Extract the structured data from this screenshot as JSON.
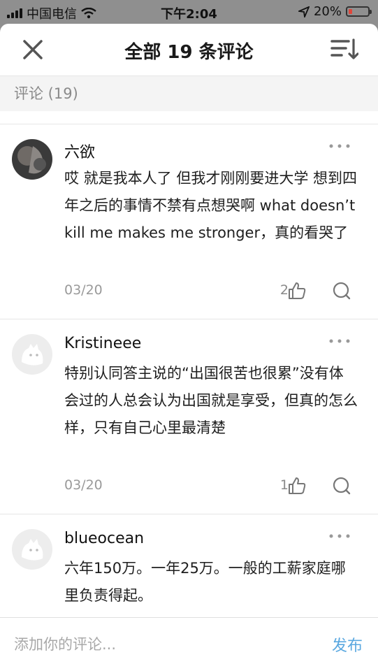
{
  "status_bar": {
    "carrier": "中国电信",
    "time": "下午2:04",
    "battery": "20%",
    "battery_level": 0.2,
    "battery_color": "#e0463a"
  },
  "header": {
    "title": "全部 19 条评论",
    "close_icon": "close-icon",
    "sort_icon": "sort-icon"
  },
  "section": {
    "label": "评论 (19)"
  },
  "comments": [
    {
      "user": "六欲",
      "text": "哎 就是我本人了 但我才刚刚要进大学 想到四年之后的事情不禁有点想哭啊 what doesn’t kill me makes me stronger，真的看哭了",
      "date": "03/20",
      "likes": "2"
    },
    {
      "user": "Kristineee",
      "text": "特别认同答主说的“出国很苦也很累”没有体会过的人总会认为出国就是享受，但真的怎么样，只有自己心里最清楚",
      "date": "03/20",
      "likes": "1"
    },
    {
      "user": "blueocean",
      "text": "六年150万。一年25万。一般的工薪家庭哪里负责得起。",
      "date": "",
      "likes": ""
    }
  ],
  "footer": {
    "placeholder": "添加你的评论...",
    "publish": "发布"
  },
  "colors": {
    "accent": "#5aa8e0",
    "muted": "#9a9a9a"
  }
}
